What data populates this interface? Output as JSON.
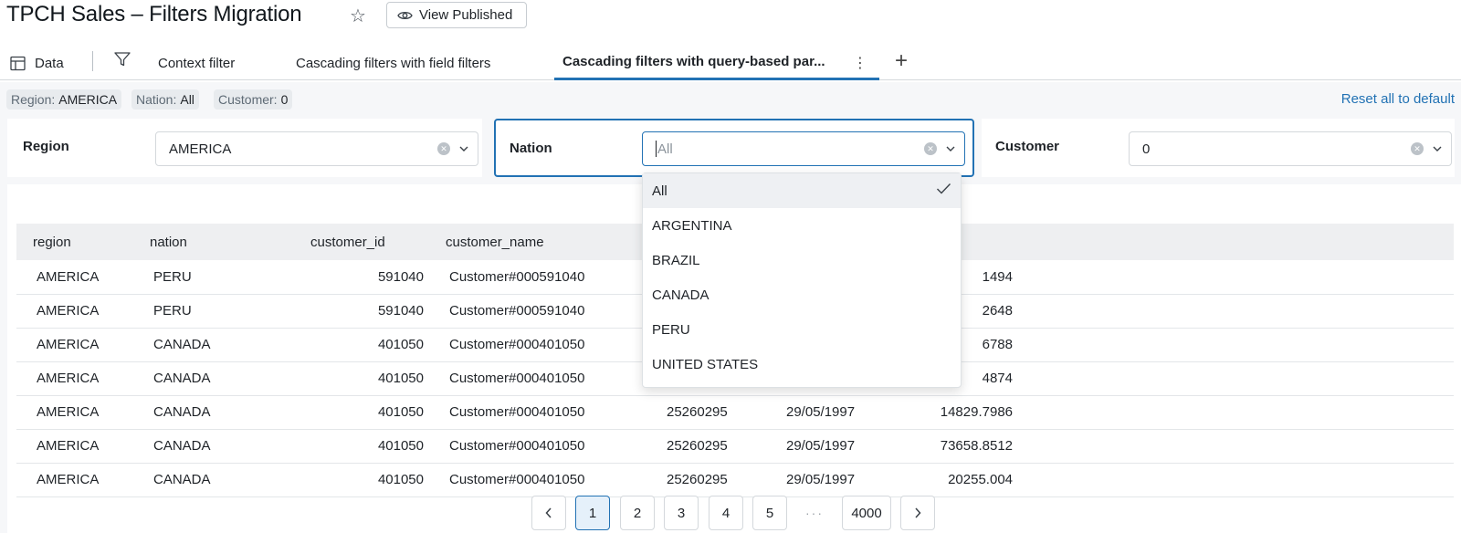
{
  "header": {
    "title": "TPCH Sales – Filters Migration",
    "view_published_label": "View Published"
  },
  "tabs": {
    "data_label": "Data",
    "items": [
      {
        "label": "Context filter"
      },
      {
        "label": "Cascading filters with field filters"
      },
      {
        "label": "Cascading filters with query-based par..."
      }
    ]
  },
  "chips": [
    {
      "key": "Region:",
      "value": "AMERICA"
    },
    {
      "key": "Nation:",
      "value": "All"
    },
    {
      "key": "Customer:",
      "value": "0"
    }
  ],
  "reset_label": "Reset all to default",
  "filters": {
    "region": {
      "label": "Region",
      "value": "AMERICA"
    },
    "nation": {
      "label": "Nation",
      "placeholder": "All"
    },
    "customer": {
      "label": "Customer",
      "value": "0"
    }
  },
  "dropdown": {
    "options": [
      "All",
      "ARGENTINA",
      "BRAZIL",
      "CANADA",
      "PERU",
      "UNITED STATES"
    ],
    "selected": "All"
  },
  "table": {
    "columns": [
      "region",
      "nation",
      "customer_id",
      "customer_name"
    ],
    "rows": [
      [
        "AMERICA",
        "PERU",
        "591040",
        "Customer#000591040",
        "",
        "",
        "1494"
      ],
      [
        "AMERICA",
        "PERU",
        "591040",
        "Customer#000591040",
        "",
        "",
        "2648"
      ],
      [
        "AMERICA",
        "CANADA",
        "401050",
        "Customer#000401050",
        "",
        "",
        "6788"
      ],
      [
        "AMERICA",
        "CANADA",
        "401050",
        "Customer#000401050",
        "",
        "",
        "4874"
      ],
      [
        "AMERICA",
        "CANADA",
        "401050",
        "Customer#000401050",
        "25260295",
        "29/05/1997",
        "14829.7986"
      ],
      [
        "AMERICA",
        "CANADA",
        "401050",
        "Customer#000401050",
        "25260295",
        "29/05/1997",
        "73658.8512"
      ],
      [
        "AMERICA",
        "CANADA",
        "401050",
        "Customer#000401050",
        "25260295",
        "29/05/1997",
        "20255.004"
      ]
    ]
  },
  "pagination": {
    "pages": [
      "1",
      "2",
      "3",
      "4",
      "5"
    ],
    "ellipsis": "···",
    "last_page": "4000",
    "current": "1"
  },
  "colors": {
    "accent": "#2272b4",
    "tab_border": "#2272b4",
    "page_bg": "#f6f7f9"
  }
}
